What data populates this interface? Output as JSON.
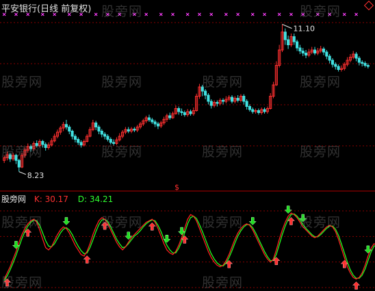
{
  "stock_title": "平安银行(日线 前复权)",
  "watermark": "股旁网",
  "indicator": {
    "name": "股旁网",
    "k_label": "K: 30.17",
    "d_label": "D: 34.21"
  },
  "colors": {
    "background": "#000000",
    "up_candle": "#ff3030",
    "down_candle": "#40e0e0",
    "k_line": "#ff2020",
    "d_line": "#20ff20",
    "magenta_marks": "#ff40ff",
    "grid": "#8b0000"
  },
  "chart_data": {
    "type": "candlestick_with_oscillator",
    "price_annotations": [
      {
        "text": "11.10",
        "kind": "high"
      },
      {
        "text": "8.23",
        "kind": "low"
      }
    ],
    "price_ylim": [
      8.0,
      11.2
    ],
    "candles": [
      [
        8.45,
        8.5,
        8.4,
        8.55
      ],
      [
        8.5,
        8.56,
        8.45,
        8.62
      ],
      [
        8.56,
        8.48,
        8.42,
        8.6
      ],
      [
        8.48,
        8.55,
        8.44,
        8.6
      ],
      [
        8.55,
        8.45,
        8.38,
        8.58
      ],
      [
        8.45,
        8.32,
        8.23,
        8.48
      ],
      [
        8.32,
        8.55,
        8.3,
        8.6
      ],
      [
        8.55,
        8.65,
        8.5,
        8.7
      ],
      [
        8.65,
        8.72,
        8.6,
        8.78
      ],
      [
        8.72,
        8.68,
        8.62,
        8.76
      ],
      [
        8.68,
        8.78,
        8.64,
        8.82
      ],
      [
        8.78,
        8.74,
        8.7,
        8.84
      ],
      [
        8.74,
        8.82,
        8.7,
        8.86
      ],
      [
        8.82,
        8.76,
        8.7,
        8.85
      ],
      [
        8.76,
        8.7,
        8.64,
        8.8
      ],
      [
        8.7,
        8.75,
        8.66,
        8.8
      ],
      [
        8.75,
        8.83,
        8.72,
        8.88
      ],
      [
        8.83,
        8.92,
        8.8,
        8.97
      ],
      [
        8.92,
        9.0,
        8.88,
        9.05
      ],
      [
        9.0,
        9.08,
        8.95,
        9.12
      ],
      [
        9.08,
        9.15,
        9.02,
        9.2
      ],
      [
        9.15,
        9.1,
        9.05,
        9.24
      ],
      [
        9.1,
        9.02,
        8.96,
        9.14
      ],
      [
        9.02,
        8.92,
        8.86,
        9.05
      ],
      [
        8.92,
        8.86,
        8.8,
        8.96
      ],
      [
        8.86,
        8.8,
        8.75,
        8.9
      ],
      [
        8.8,
        8.75,
        8.7,
        8.84
      ],
      [
        8.75,
        8.82,
        8.72,
        8.86
      ],
      [
        8.82,
        8.92,
        8.8,
        8.96
      ],
      [
        8.92,
        9.05,
        8.9,
        9.1
      ],
      [
        9.05,
        9.18,
        9.02,
        9.24
      ],
      [
        9.18,
        9.1,
        9.04,
        9.22
      ],
      [
        9.1,
        9.02,
        8.96,
        9.14
      ],
      [
        9.02,
        8.96,
        8.9,
        9.06
      ],
      [
        8.96,
        8.92,
        8.86,
        9.0
      ],
      [
        8.92,
        8.86,
        8.82,
        8.96
      ],
      [
        8.86,
        8.8,
        8.76,
        8.9
      ],
      [
        8.8,
        8.78,
        8.74,
        8.86
      ],
      [
        8.78,
        8.85,
        8.75,
        8.9
      ],
      [
        8.85,
        8.92,
        8.82,
        8.98
      ],
      [
        8.92,
        9.0,
        8.88,
        9.04
      ],
      [
        9.0,
        9.05,
        8.96,
        9.1
      ],
      [
        9.05,
        9.02,
        8.98,
        9.1
      ],
      [
        9.02,
        9.06,
        8.98,
        9.1
      ],
      [
        9.06,
        9.04,
        9.0,
        9.1
      ],
      [
        9.04,
        9.1,
        9.0,
        9.14
      ],
      [
        9.1,
        9.16,
        9.06,
        9.2
      ],
      [
        9.16,
        9.22,
        9.12,
        9.26
      ],
      [
        9.22,
        9.28,
        9.18,
        9.32
      ],
      [
        9.28,
        9.24,
        9.2,
        9.34
      ],
      [
        9.24,
        9.2,
        9.16,
        9.28
      ],
      [
        9.2,
        9.16,
        9.1,
        9.24
      ],
      [
        9.16,
        9.12,
        9.06,
        9.2
      ],
      [
        9.12,
        9.18,
        9.08,
        9.22
      ],
      [
        9.18,
        9.25,
        9.14,
        9.3
      ],
      [
        9.25,
        9.32,
        9.2,
        9.36
      ],
      [
        9.32,
        9.28,
        9.24,
        9.38
      ],
      [
        9.28,
        9.36,
        9.26,
        9.4
      ],
      [
        9.36,
        9.46,
        9.34,
        9.52
      ],
      [
        9.46,
        9.4,
        9.34,
        9.5
      ],
      [
        9.4,
        9.38,
        9.32,
        9.46
      ],
      [
        9.38,
        9.34,
        9.3,
        9.42
      ],
      [
        9.34,
        9.4,
        9.3,
        9.45
      ],
      [
        9.4,
        9.36,
        9.32,
        9.44
      ],
      [
        9.36,
        9.42,
        9.32,
        9.48
      ],
      [
        9.42,
        9.7,
        9.4,
        9.75
      ],
      [
        9.7,
        9.88,
        9.65,
        9.94
      ],
      [
        9.88,
        9.8,
        9.7,
        9.92
      ],
      [
        9.8,
        9.72,
        9.64,
        9.84
      ],
      [
        9.72,
        9.6,
        9.54,
        9.76
      ],
      [
        9.6,
        9.52,
        9.46,
        9.64
      ],
      [
        9.52,
        9.58,
        9.48,
        9.62
      ],
      [
        9.58,
        9.56,
        9.5,
        9.62
      ],
      [
        9.56,
        9.62,
        9.52,
        9.66
      ],
      [
        9.62,
        9.6,
        9.54,
        9.66
      ],
      [
        9.6,
        9.64,
        9.56,
        9.7
      ],
      [
        9.64,
        9.68,
        9.6,
        9.72
      ],
      [
        9.68,
        9.6,
        9.56,
        9.72
      ],
      [
        9.6,
        9.66,
        9.56,
        9.7
      ],
      [
        9.66,
        9.62,
        9.58,
        9.72
      ],
      [
        9.62,
        9.7,
        9.58,
        9.74
      ],
      [
        9.7,
        9.6,
        9.54,
        9.74
      ],
      [
        9.6,
        9.5,
        9.44,
        9.64
      ],
      [
        9.5,
        9.44,
        9.4,
        9.54
      ],
      [
        9.44,
        9.4,
        9.36,
        9.48
      ],
      [
        9.4,
        9.42,
        9.36,
        9.46
      ],
      [
        9.42,
        9.38,
        9.34,
        9.46
      ],
      [
        9.38,
        9.44,
        9.34,
        9.48
      ],
      [
        9.44,
        9.4,
        9.36,
        9.48
      ],
      [
        9.4,
        9.46,
        9.36,
        9.5
      ],
      [
        9.46,
        9.7,
        9.44,
        9.76
      ],
      [
        9.7,
        9.92,
        9.66,
        9.98
      ],
      [
        9.92,
        10.3,
        9.9,
        10.38
      ],
      [
        10.3,
        10.6,
        10.26,
        10.7
      ],
      [
        10.6,
        10.95,
        10.56,
        11.1
      ],
      [
        10.95,
        10.8,
        10.7,
        11.02
      ],
      [
        10.8,
        10.7,
        10.62,
        10.88
      ],
      [
        10.7,
        10.86,
        10.66,
        10.92
      ],
      [
        10.86,
        10.76,
        10.7,
        10.92
      ],
      [
        10.76,
        10.64,
        10.58,
        10.8
      ],
      [
        10.64,
        10.58,
        10.52,
        10.7
      ],
      [
        10.58,
        10.54,
        10.48,
        10.64
      ],
      [
        10.54,
        10.5,
        10.44,
        10.6
      ],
      [
        10.5,
        10.56,
        10.46,
        10.62
      ],
      [
        10.56,
        10.6,
        10.52,
        10.66
      ],
      [
        10.6,
        10.54,
        10.5,
        10.66
      ],
      [
        10.54,
        10.58,
        10.5,
        10.64
      ],
      [
        10.58,
        10.62,
        10.54,
        10.68
      ],
      [
        10.62,
        10.56,
        10.5,
        10.66
      ],
      [
        10.56,
        10.48,
        10.42,
        10.6
      ],
      [
        10.48,
        10.4,
        10.34,
        10.52
      ],
      [
        10.4,
        10.32,
        10.26,
        10.44
      ],
      [
        10.32,
        10.28,
        10.22,
        10.36
      ],
      [
        10.28,
        10.22,
        10.18,
        10.32
      ],
      [
        10.22,
        10.24,
        10.18,
        10.3
      ],
      [
        10.24,
        10.32,
        10.2,
        10.36
      ],
      [
        10.32,
        10.4,
        10.28,
        10.46
      ],
      [
        10.4,
        10.46,
        10.36,
        10.52
      ],
      [
        10.46,
        10.52,
        10.42,
        10.58
      ],
      [
        10.52,
        10.44,
        10.38,
        10.56
      ],
      [
        10.44,
        10.36,
        10.3,
        10.48
      ],
      [
        10.36,
        10.34,
        10.28,
        10.4
      ],
      [
        10.34,
        10.3,
        10.26,
        10.38
      ],
      [
        10.3,
        10.28,
        10.24,
        10.34
      ]
    ],
    "k_values": [
      4,
      12,
      20,
      30,
      40,
      52,
      62,
      70,
      76,
      80,
      82,
      78,
      68,
      56,
      45,
      42,
      46,
      54,
      62,
      68,
      72,
      70,
      64,
      56,
      48,
      42,
      36,
      34,
      40,
      50,
      62,
      72,
      80,
      84,
      82,
      76,
      68,
      60,
      52,
      46,
      42,
      46,
      52,
      58,
      62,
      66,
      70,
      74,
      78,
      80,
      82,
      78,
      70,
      60,
      50,
      42,
      38,
      36,
      40,
      48,
      58,
      70,
      82,
      88,
      86,
      80,
      70,
      60,
      50,
      40,
      32,
      26,
      22,
      20,
      22,
      28,
      36,
      46,
      56,
      64,
      70,
      74,
      76,
      74,
      68,
      60,
      52,
      44,
      36,
      30,
      26,
      30,
      42,
      56,
      68,
      78,
      86,
      90,
      88,
      84,
      78,
      72,
      68,
      64,
      60,
      58,
      60,
      64,
      68,
      72,
      74,
      72,
      66,
      56,
      44,
      32,
      20,
      12,
      6,
      4,
      6,
      12,
      22,
      34,
      44,
      50,
      48,
      44,
      40,
      36
    ],
    "d_values": [
      2,
      8,
      16,
      25,
      35,
      46,
      57,
      66,
      73,
      78,
      81,
      80,
      74,
      64,
      54,
      47,
      46,
      50,
      57,
      64,
      69,
      71,
      68,
      62,
      54,
      47,
      41,
      37,
      38,
      45,
      55,
      66,
      75,
      81,
      82,
      79,
      72,
      64,
      56,
      50,
      45,
      46,
      50,
      55,
      60,
      63,
      67,
      72,
      76,
      79,
      81,
      80,
      74,
      66,
      56,
      48,
      42,
      38,
      38,
      44,
      53,
      64,
      76,
      84,
      86,
      83,
      75,
      66,
      56,
      46,
      37,
      30,
      25,
      22,
      21,
      25,
      32,
      41,
      51,
      60,
      67,
      72,
      75,
      75,
      71,
      64,
      56,
      48,
      40,
      33,
      28,
      28,
      36,
      49,
      62,
      73,
      82,
      88,
      89,
      86,
      81,
      75,
      70,
      66,
      62,
      59,
      59,
      62,
      66,
      70,
      73,
      73,
      69,
      61,
      50,
      38,
      26,
      16,
      9,
      5,
      5,
      9,
      17,
      28,
      39,
      47,
      48,
      46,
      42,
      38
    ],
    "osc_ylim": [
      0,
      100
    ],
    "signals_up_index": [
      1,
      8,
      28,
      34,
      50,
      61,
      76,
      92,
      97,
      115,
      119
    ],
    "signals_down_index": [
      4,
      21,
      42,
      55,
      60,
      84,
      96,
      101,
      123
    ],
    "magenta_mark_count": 28
  }
}
